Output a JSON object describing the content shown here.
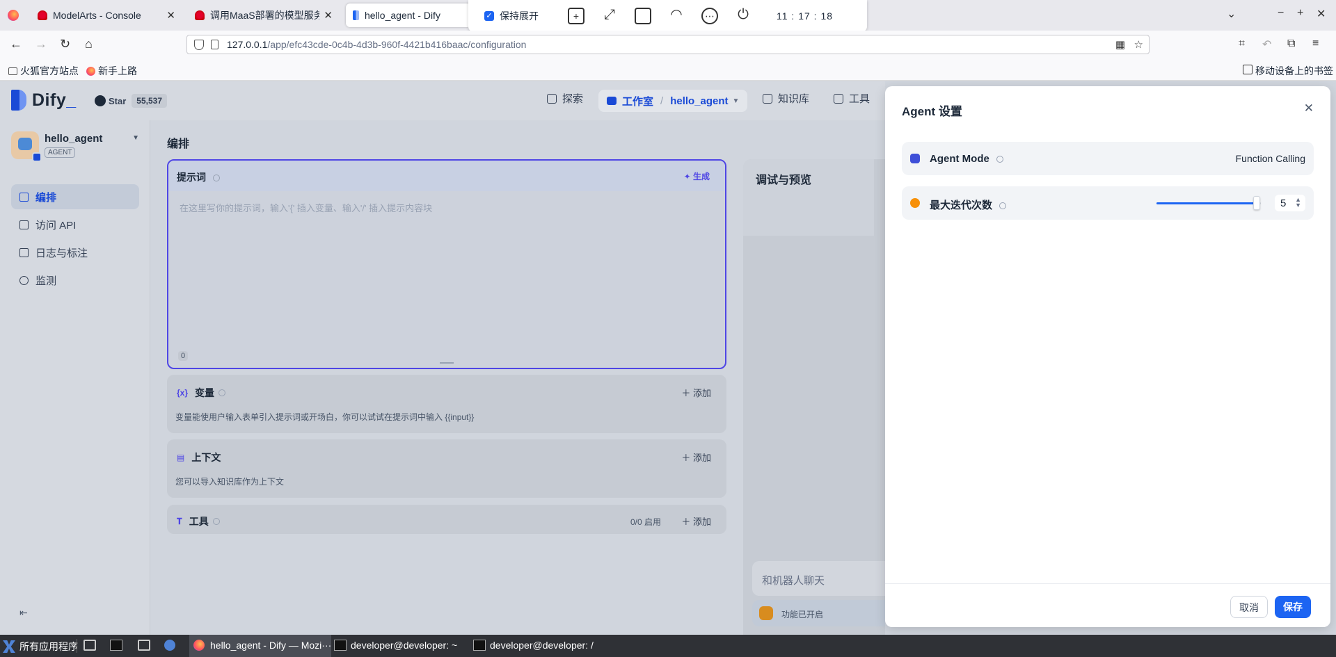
{
  "browser": {
    "tabs": [
      {
        "title": "ModelArts - Console",
        "active": false
      },
      {
        "title": "调用MaaS部署的模型服务_/",
        "active": false
      },
      {
        "title": "hello_agent - Dify",
        "active": true
      }
    ],
    "url_host": "127.0.0.1",
    "url_path": "/app/efc43cde-0c4b-4d3b-960f-4421b416baac/configuration",
    "bookmarks": [
      "火狐官方站点",
      "新手上路"
    ],
    "mobile_bookmarks": "移动设备上的书签"
  },
  "floatbar": {
    "keep_expanded": "保持展开",
    "clock": "11 : 17 : 18"
  },
  "app": {
    "logo": "Dify",
    "github_star": "Star",
    "github_count": "55,537",
    "nav": {
      "explore": "探索",
      "studio": "工作室",
      "current_app": "hello_agent",
      "knowledge": "知识库",
      "tools": "工具"
    },
    "sidebar": {
      "app_name": "hello_agent",
      "app_type": "AGENT",
      "items": [
        "编排",
        "访问 API",
        "日志与标注",
        "监测"
      ]
    },
    "main": {
      "title": "编排",
      "prompt": {
        "title": "提示词",
        "generate": "生成",
        "placeholder": "在这里写你的提示词，输入'{' 插入变量、输入'/' 插入提示内容块",
        "count": "0"
      },
      "variables": {
        "title": "变量",
        "add": "添加",
        "desc": "变量能使用户输入表单引入提示词或开场白，你可以试试在提示词中输入 {{input}}"
      },
      "context": {
        "title": "上下文",
        "add": "添加",
        "desc": "您可以导入知识库作为上下文"
      },
      "tools": {
        "title": "工具",
        "enabled": "0/0 启用",
        "add": "添加"
      }
    },
    "debug": {
      "title": "调试与预览",
      "chat_placeholder": "和机器人聊天",
      "feature": "功能已开启"
    }
  },
  "drawer": {
    "title": "Agent 设置",
    "agent_mode_label": "Agent Mode",
    "agent_mode_value": "Function Calling",
    "max_iter_label": "最大迭代次数",
    "max_iter_value": "5",
    "max_iter_fraction": 0.96,
    "cancel": "取消",
    "save": "保存"
  },
  "taskbar": {
    "start": "所有应用程序",
    "windows": [
      "hello_agent - Dify — Mozi···",
      "developer@developer: ~",
      "developer@developer: /"
    ]
  }
}
